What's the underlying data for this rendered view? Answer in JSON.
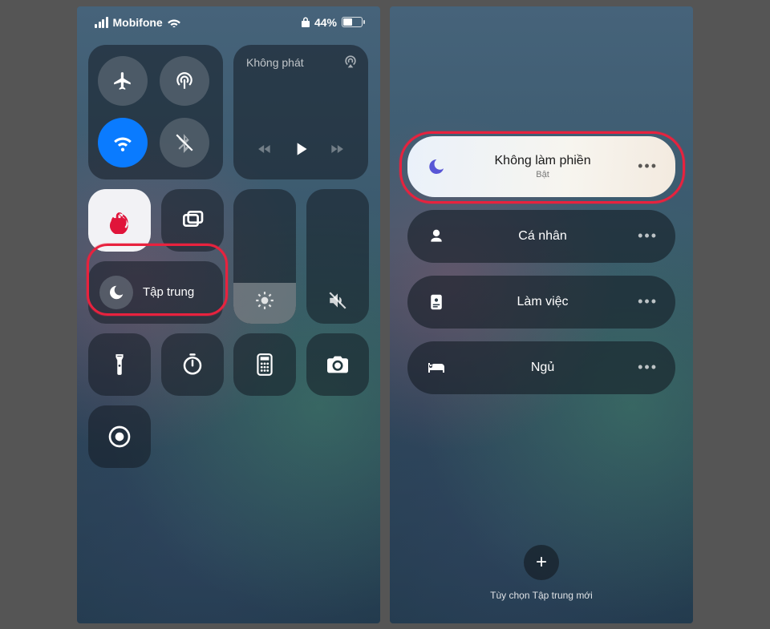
{
  "statusbar": {
    "carrier": "Mobifone",
    "battery_pct": "44%"
  },
  "left": {
    "media_title": "Không phát",
    "focus_label": "Tập trung"
  },
  "right": {
    "items": [
      {
        "label": "Không làm phiền",
        "sub": "Bật"
      },
      {
        "label": "Cá nhân"
      },
      {
        "label": "Làm việc"
      },
      {
        "label": "Ngủ"
      }
    ],
    "add_caption": "Tùy chọn Tập trung mới"
  },
  "colors": {
    "accent_blue": "#0a7bff",
    "highlight_red": "#e8223e",
    "dnd_purple": "#5856d6"
  }
}
